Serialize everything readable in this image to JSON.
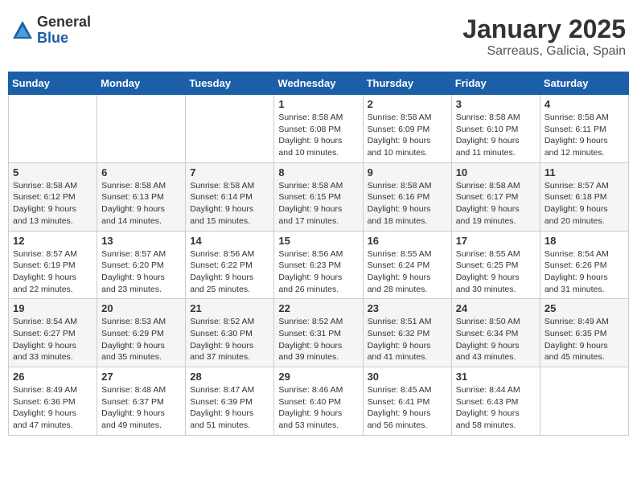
{
  "logo": {
    "general": "General",
    "blue": "Blue"
  },
  "title": "January 2025",
  "location": "Sarreaus, Galicia, Spain",
  "weekdays": [
    "Sunday",
    "Monday",
    "Tuesday",
    "Wednesday",
    "Thursday",
    "Friday",
    "Saturday"
  ],
  "rows": [
    [
      {
        "day": "",
        "info": ""
      },
      {
        "day": "",
        "info": ""
      },
      {
        "day": "",
        "info": ""
      },
      {
        "day": "1",
        "info": "Sunrise: 8:58 AM\nSunset: 6:08 PM\nDaylight: 9 hours\nand 10 minutes."
      },
      {
        "day": "2",
        "info": "Sunrise: 8:58 AM\nSunset: 6:09 PM\nDaylight: 9 hours\nand 10 minutes."
      },
      {
        "day": "3",
        "info": "Sunrise: 8:58 AM\nSunset: 6:10 PM\nDaylight: 9 hours\nand 11 minutes."
      },
      {
        "day": "4",
        "info": "Sunrise: 8:58 AM\nSunset: 6:11 PM\nDaylight: 9 hours\nand 12 minutes."
      }
    ],
    [
      {
        "day": "5",
        "info": "Sunrise: 8:58 AM\nSunset: 6:12 PM\nDaylight: 9 hours\nand 13 minutes."
      },
      {
        "day": "6",
        "info": "Sunrise: 8:58 AM\nSunset: 6:13 PM\nDaylight: 9 hours\nand 14 minutes."
      },
      {
        "day": "7",
        "info": "Sunrise: 8:58 AM\nSunset: 6:14 PM\nDaylight: 9 hours\nand 15 minutes."
      },
      {
        "day": "8",
        "info": "Sunrise: 8:58 AM\nSunset: 6:15 PM\nDaylight: 9 hours\nand 17 minutes."
      },
      {
        "day": "9",
        "info": "Sunrise: 8:58 AM\nSunset: 6:16 PM\nDaylight: 9 hours\nand 18 minutes."
      },
      {
        "day": "10",
        "info": "Sunrise: 8:58 AM\nSunset: 6:17 PM\nDaylight: 9 hours\nand 19 minutes."
      },
      {
        "day": "11",
        "info": "Sunrise: 8:57 AM\nSunset: 6:18 PM\nDaylight: 9 hours\nand 20 minutes."
      }
    ],
    [
      {
        "day": "12",
        "info": "Sunrise: 8:57 AM\nSunset: 6:19 PM\nDaylight: 9 hours\nand 22 minutes."
      },
      {
        "day": "13",
        "info": "Sunrise: 8:57 AM\nSunset: 6:20 PM\nDaylight: 9 hours\nand 23 minutes."
      },
      {
        "day": "14",
        "info": "Sunrise: 8:56 AM\nSunset: 6:22 PM\nDaylight: 9 hours\nand 25 minutes."
      },
      {
        "day": "15",
        "info": "Sunrise: 8:56 AM\nSunset: 6:23 PM\nDaylight: 9 hours\nand 26 minutes."
      },
      {
        "day": "16",
        "info": "Sunrise: 8:55 AM\nSunset: 6:24 PM\nDaylight: 9 hours\nand 28 minutes."
      },
      {
        "day": "17",
        "info": "Sunrise: 8:55 AM\nSunset: 6:25 PM\nDaylight: 9 hours\nand 30 minutes."
      },
      {
        "day": "18",
        "info": "Sunrise: 8:54 AM\nSunset: 6:26 PM\nDaylight: 9 hours\nand 31 minutes."
      }
    ],
    [
      {
        "day": "19",
        "info": "Sunrise: 8:54 AM\nSunset: 6:27 PM\nDaylight: 9 hours\nand 33 minutes."
      },
      {
        "day": "20",
        "info": "Sunrise: 8:53 AM\nSunset: 6:29 PM\nDaylight: 9 hours\nand 35 minutes."
      },
      {
        "day": "21",
        "info": "Sunrise: 8:52 AM\nSunset: 6:30 PM\nDaylight: 9 hours\nand 37 minutes."
      },
      {
        "day": "22",
        "info": "Sunrise: 8:52 AM\nSunset: 6:31 PM\nDaylight: 9 hours\nand 39 minutes."
      },
      {
        "day": "23",
        "info": "Sunrise: 8:51 AM\nSunset: 6:32 PM\nDaylight: 9 hours\nand 41 minutes."
      },
      {
        "day": "24",
        "info": "Sunrise: 8:50 AM\nSunset: 6:34 PM\nDaylight: 9 hours\nand 43 minutes."
      },
      {
        "day": "25",
        "info": "Sunrise: 8:49 AM\nSunset: 6:35 PM\nDaylight: 9 hours\nand 45 minutes."
      }
    ],
    [
      {
        "day": "26",
        "info": "Sunrise: 8:49 AM\nSunset: 6:36 PM\nDaylight: 9 hours\nand 47 minutes."
      },
      {
        "day": "27",
        "info": "Sunrise: 8:48 AM\nSunset: 6:37 PM\nDaylight: 9 hours\nand 49 minutes."
      },
      {
        "day": "28",
        "info": "Sunrise: 8:47 AM\nSunset: 6:39 PM\nDaylight: 9 hours\nand 51 minutes."
      },
      {
        "day": "29",
        "info": "Sunrise: 8:46 AM\nSunset: 6:40 PM\nDaylight: 9 hours\nand 53 minutes."
      },
      {
        "day": "30",
        "info": "Sunrise: 8:45 AM\nSunset: 6:41 PM\nDaylight: 9 hours\nand 56 minutes."
      },
      {
        "day": "31",
        "info": "Sunrise: 8:44 AM\nSunset: 6:43 PM\nDaylight: 9 hours\nand 58 minutes."
      },
      {
        "day": "",
        "info": ""
      }
    ]
  ]
}
